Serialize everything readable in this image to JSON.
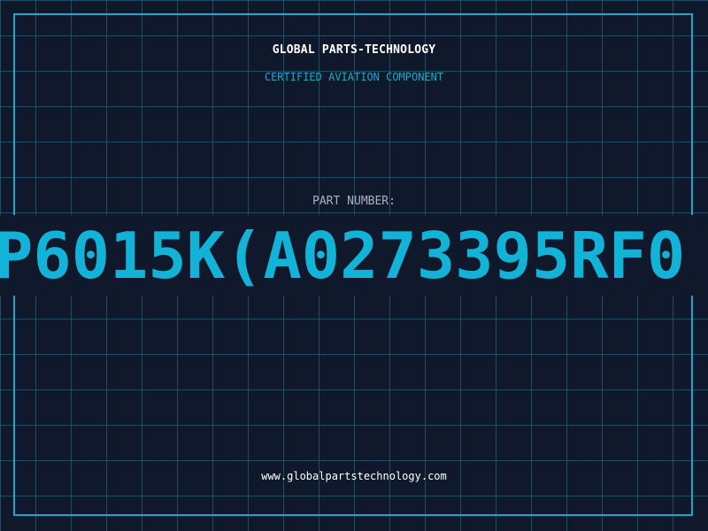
{
  "header": {
    "brand": "GLOBAL PARTS-TECHNOLOGY",
    "tagline": "CERTIFIED AVIATION COMPONENT"
  },
  "part": {
    "label": "PART NUMBER:",
    "number": "P6015K(A0273395RF0"
  },
  "footer": {
    "url": "www.globalpartstechnology.com"
  },
  "colors": {
    "background": "#0f192b",
    "grid": "#22607a",
    "accent": "#12b3d7",
    "frame": "#1aa7c9"
  }
}
